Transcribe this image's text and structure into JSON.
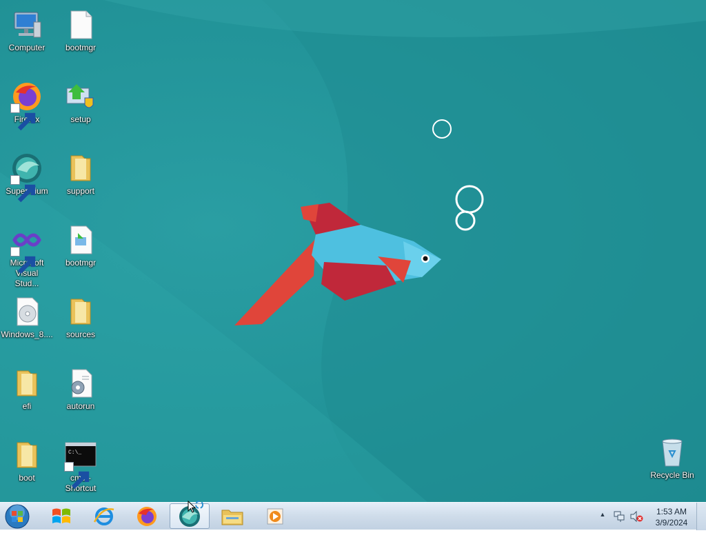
{
  "desktop": {
    "icons": [
      {
        "label": "Computer",
        "icon": "computer-icon"
      },
      {
        "label": "bootmgr",
        "icon": "file-icon"
      },
      {
        "label": "Firefox",
        "icon": "firefox-icon"
      },
      {
        "label": "setup",
        "icon": "setup-icon"
      },
      {
        "label": "Supermium",
        "icon": "supermium-icon"
      },
      {
        "label": "support",
        "icon": "folder-icon"
      },
      {
        "label": "Microsoft Visual Stud...",
        "icon": "visual-studio-icon"
      },
      {
        "label": "bootmgr",
        "icon": "efi-file-icon"
      },
      {
        "label": "Windows_8....",
        "icon": "disc-image-icon"
      },
      {
        "label": "sources",
        "icon": "folder-icon"
      },
      {
        "label": "efi",
        "icon": "folder-icon"
      },
      {
        "label": "autorun",
        "icon": "settings-file-icon"
      },
      {
        "label": "boot",
        "icon": "folder-icon"
      },
      {
        "label": "cmd - Shortcut",
        "icon": "cmd-icon"
      },
      {
        "label": "Recycle Bin",
        "icon": "recycle-bin-icon"
      }
    ]
  },
  "taskbar": {
    "pinned": [
      {
        "name": "windows-logo-icon"
      },
      {
        "name": "internet-explorer-icon"
      },
      {
        "name": "firefox-icon"
      },
      {
        "name": "supermium-icon",
        "active": true
      },
      {
        "name": "file-explorer-icon"
      },
      {
        "name": "media-player-icon"
      }
    ],
    "tray": {
      "show_hidden": "▲",
      "icons": [
        "network-icon",
        "volume-muted-icon"
      ]
    },
    "clock": {
      "time": "1:53 AM",
      "date": "3/9/2024"
    }
  },
  "colors": {
    "wallpaper": "#23959a",
    "fish_body": "#4ec0e0",
    "fish_fin_red": "#c0283a",
    "fish_fin_orange": "#e0453a"
  }
}
